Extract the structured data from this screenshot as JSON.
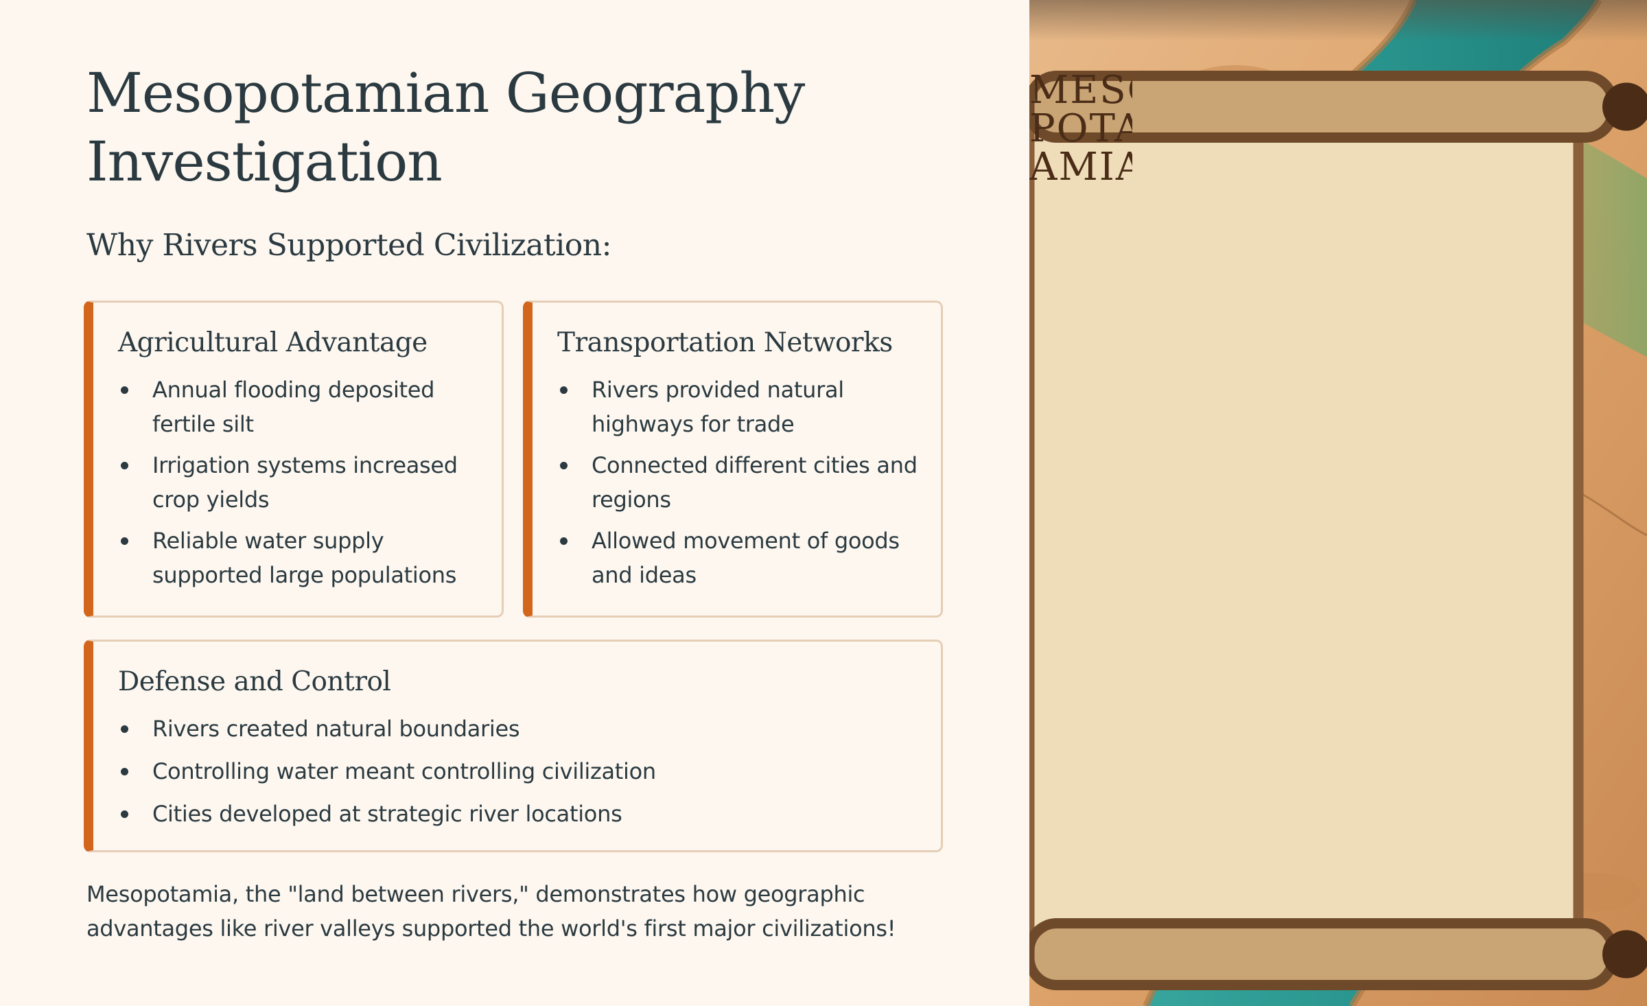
{
  "title": "Mesopotamian Geography Investigation",
  "subtitle": "Why Rivers Supported Civilization:",
  "cards": [
    {
      "title": "Agricultural Advantage",
      "items": [
        "Annual flooding deposited fertile silt",
        "Irrigation systems increased crop yields",
        "Reliable water supply supported large populations"
      ]
    },
    {
      "title": "Transportation Networks",
      "items": [
        "Rivers provided natural highways for trade",
        "Connected different cities and regions",
        "Allowed movement of goods and ideas"
      ]
    },
    {
      "title": "Defense and Control",
      "items": [
        "Rivers created natural boundaries",
        "Controlling water meant controlling civilization",
        "Cities developed at strategic river locations"
      ]
    }
  ],
  "conclusion": "Mesopotamia, the \"land between rivers,\" demonstrates how geographic advantages like river valleys supported the world's first major civilizations!",
  "map_image": {
    "scroll_lines": [
      "MESO",
      "POTA",
      "AMIA"
    ]
  },
  "colors": {
    "background": "#fdf7f0",
    "accent": "#d2661d",
    "card_border": "#e6cdb6",
    "text": "#2b3a40",
    "river": "#2e9c94",
    "land": "#d9a56f"
  }
}
